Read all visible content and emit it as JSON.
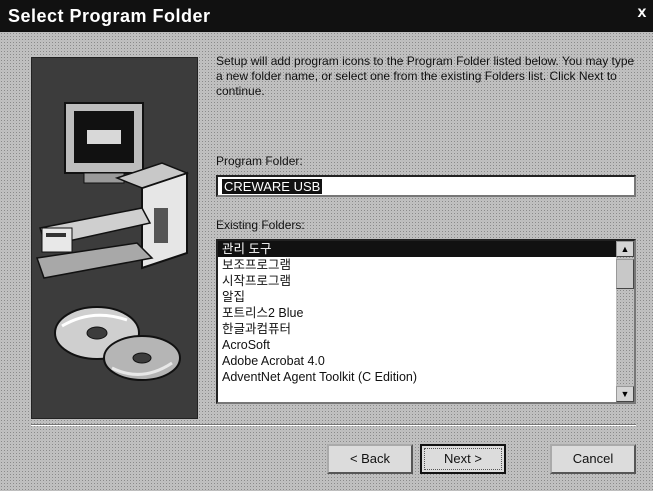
{
  "window": {
    "title": "Select Program Folder",
    "close_glyph": "x"
  },
  "description": "Setup will add program icons to the Program Folder listed below. You may type a new folder name, or select one from the existing Folders list. Click Next to continue.",
  "program_folder": {
    "label": "Program Folder:",
    "value": "CREWARE USB"
  },
  "existing_folders": {
    "label": "Existing Folders:",
    "items": [
      "관리 도구",
      "보조프로그램",
      "시작프로그램",
      "알집",
      "포트리스2 Blue",
      "한글과컴퓨터",
      "AcroSoft",
      "Adobe Acrobat 4.0",
      "AdventNet Agent Toolkit (C Edition)"
    ],
    "selected_index": 0
  },
  "buttons": {
    "back": "< Back",
    "next": "Next >",
    "cancel": "Cancel"
  },
  "icons": {
    "close": "close-icon",
    "scroll_up": "arrow-up-icon",
    "scroll_down": "arrow-down-icon"
  }
}
